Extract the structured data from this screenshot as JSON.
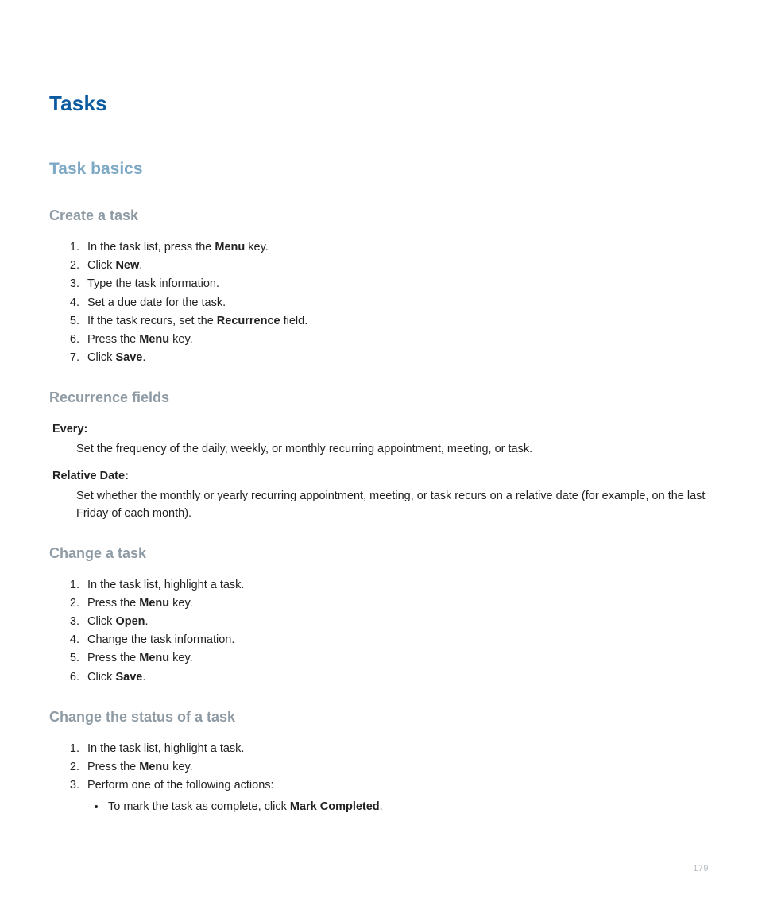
{
  "page_number": "179",
  "title": "Tasks",
  "sections": {
    "task_basics": {
      "heading": "Task basics",
      "create_task": {
        "heading": "Create a task",
        "steps": [
          [
            {
              "t": "In the task list, press the "
            },
            {
              "t": "Menu",
              "b": true
            },
            {
              "t": " key."
            }
          ],
          [
            {
              "t": "Click "
            },
            {
              "t": "New",
              "b": true
            },
            {
              "t": "."
            }
          ],
          [
            {
              "t": "Type the task information."
            }
          ],
          [
            {
              "t": "Set a due date for the task."
            }
          ],
          [
            {
              "t": "If the task recurs, set the "
            },
            {
              "t": "Recurrence",
              "b": true
            },
            {
              "t": " field."
            }
          ],
          [
            {
              "t": "Press the "
            },
            {
              "t": "Menu",
              "b": true
            },
            {
              "t": " key."
            }
          ],
          [
            {
              "t": "Click "
            },
            {
              "t": "Save",
              "b": true
            },
            {
              "t": "."
            }
          ]
        ]
      },
      "recurrence_fields": {
        "heading": "Recurrence fields",
        "definitions": [
          {
            "term": "Every:",
            "def": [
              {
                "t": "Set the frequency of the daily, weekly, or monthly recurring appointment, meeting, or task."
              }
            ]
          },
          {
            "term": "Relative Date:",
            "def": [
              {
                "t": "Set whether the monthly or yearly recurring appointment, meeting, or task recurs on a relative date (for example, on the last Friday of each month)."
              }
            ]
          }
        ]
      },
      "change_task": {
        "heading": "Change a task",
        "steps": [
          [
            {
              "t": "In the task list, highlight a task."
            }
          ],
          [
            {
              "t": "Press the "
            },
            {
              "t": "Menu",
              "b": true
            },
            {
              "t": " key."
            }
          ],
          [
            {
              "t": "Click "
            },
            {
              "t": "Open",
              "b": true
            },
            {
              "t": "."
            }
          ],
          [
            {
              "t": "Change the task information."
            }
          ],
          [
            {
              "t": "Press the "
            },
            {
              "t": "Menu",
              "b": true
            },
            {
              "t": " key."
            }
          ],
          [
            {
              "t": "Click "
            },
            {
              "t": "Save",
              "b": true
            },
            {
              "t": "."
            }
          ]
        ]
      },
      "change_status": {
        "heading": "Change the status of a task",
        "steps": [
          [
            {
              "t": "In the task list, highlight a task."
            }
          ],
          [
            {
              "t": "Press the "
            },
            {
              "t": "Menu",
              "b": true
            },
            {
              "t": " key."
            }
          ],
          [
            {
              "t": "Perform one of the following actions:"
            }
          ]
        ],
        "sub_bullets": [
          [
            {
              "t": "To mark the task as complete, click "
            },
            {
              "t": "Mark Completed",
              "b": true
            },
            {
              "t": "."
            }
          ]
        ]
      }
    }
  }
}
